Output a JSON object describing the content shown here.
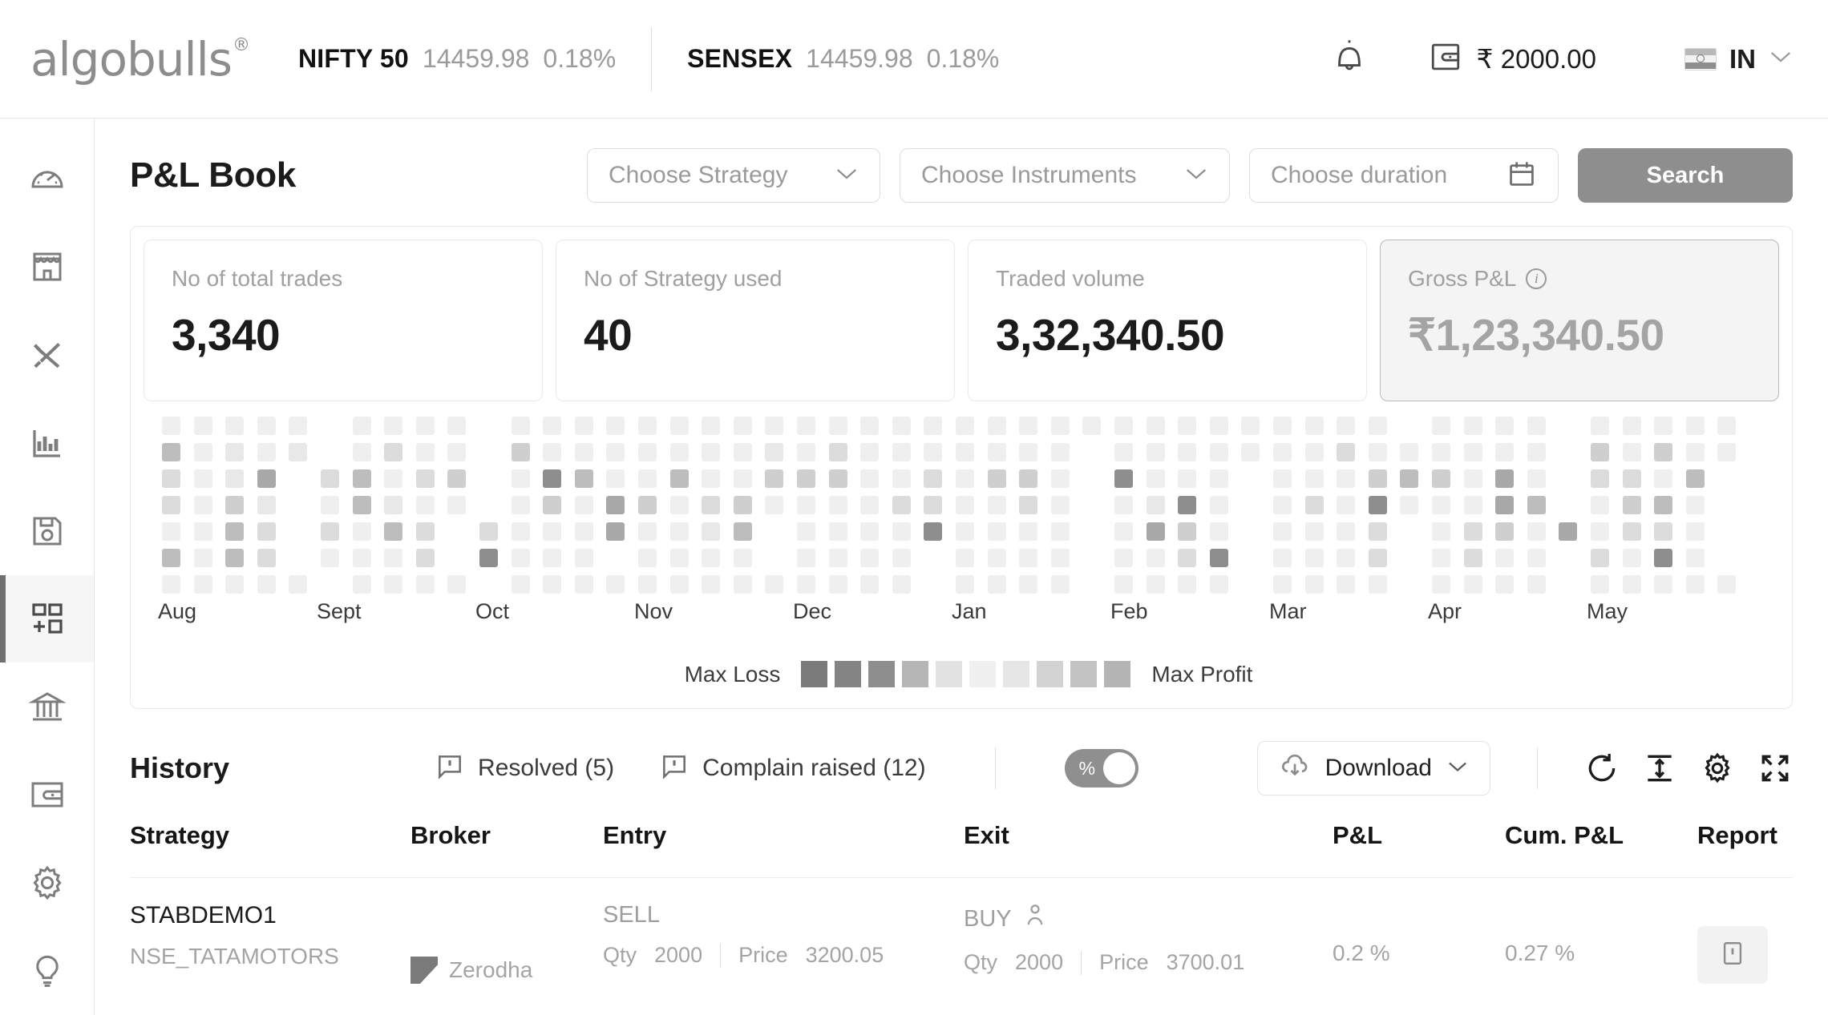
{
  "header": {
    "logo_text": "algobulls",
    "logo_reg": "®",
    "tickers": [
      {
        "name": "NIFTY 50",
        "value": "14459.98",
        "percent": "0.18%"
      },
      {
        "name": "SENSEX",
        "value": "14459.98",
        "percent": "0.18%"
      }
    ],
    "notification_icon": "bell-icon",
    "wallet_icon": "wallet-icon",
    "wallet_amount": "₹ 2000.00",
    "region_code": "IN",
    "region_chevron": "chevron-down-icon"
  },
  "sidebar": {
    "items": [
      {
        "name": "dashboard",
        "icon": "speedometer-icon",
        "active": false
      },
      {
        "name": "marketplace",
        "icon": "store-icon",
        "active": false
      },
      {
        "name": "tools",
        "icon": "tools-icon",
        "active": false
      },
      {
        "name": "analytics",
        "icon": "bar-chart-icon",
        "active": false
      },
      {
        "name": "saved",
        "icon": "floppy-disk-icon",
        "active": false
      },
      {
        "name": "pnl-book",
        "icon": "grid-plus-icon",
        "active": true
      },
      {
        "name": "bank",
        "icon": "bank-icon",
        "active": false
      },
      {
        "name": "wallet",
        "icon": "wallet-icon",
        "active": false
      },
      {
        "name": "settings",
        "icon": "gear-icon",
        "active": false
      },
      {
        "name": "help",
        "icon": "lightbulb-icon",
        "active": false
      }
    ]
  },
  "page": {
    "title": "P&L Book",
    "filters": {
      "strategy_placeholder": "Choose Strategy",
      "instruments_placeholder": "Choose Instruments",
      "duration_placeholder": "Choose duration",
      "calendar_icon": "calendar-icon",
      "chevron_icon": "chevron-down-icon",
      "search_label": "Search"
    }
  },
  "stats": [
    {
      "label": "No of total trades",
      "value": "3,340",
      "info": false,
      "highlight": false
    },
    {
      "label": "No of Strategy used",
      "value": "40",
      "info": false,
      "highlight": false
    },
    {
      "label": "Traded volume",
      "value": "3,32,340.50",
      "info": false,
      "highlight": false
    },
    {
      "label": "Gross P&L",
      "value": "₹1,23,340.50",
      "info": true,
      "highlight": true
    }
  ],
  "chart_data": {
    "type": "heatmap",
    "title": "",
    "xlabel": "",
    "ylabel": "",
    "legend_position": "bottom-center",
    "legend_min_label": "Max Loss",
    "legend_max_label": "Max Profit",
    "legend_swatches": [
      "#7b7b7b",
      "#848484",
      "#8e8e8e",
      "#b6b6b6",
      "#e2e2e2",
      "#f0f0f0",
      "#e6e6e6",
      "#d3d3d3",
      "#c3c3c3",
      "#b4b4b4"
    ],
    "categories": [
      "Aug",
      "Sept",
      "Oct",
      "Nov",
      "Dec",
      "Jan",
      "Feb",
      "Mar",
      "Apr",
      "May"
    ],
    "rows": 7,
    "cols_per_month": 5,
    "scale": [
      "#f7f7f7",
      "#efefef",
      "#e8e8e8",
      "#dcdcdc",
      "#cfcfcf",
      "#bdbdbd",
      "#a8a8a8",
      "#8e8e8e",
      "#7c7c7c"
    ],
    "values": [
      {
        "month": "Aug",
        "grid": [
          [
            1,
            1,
            1,
            1,
            1
          ],
          [
            5,
            1,
            2,
            1,
            2
          ],
          [
            3,
            1,
            2,
            6,
            0
          ],
          [
            3,
            1,
            4,
            2,
            0
          ],
          [
            1,
            1,
            5,
            3,
            0
          ],
          [
            5,
            1,
            5,
            3,
            0
          ],
          [
            1,
            1,
            1,
            1,
            1
          ]
        ]
      },
      {
        "month": "Sept",
        "grid": [
          [
            0,
            1,
            1,
            1,
            1
          ],
          [
            0,
            1,
            3,
            1,
            1
          ],
          [
            3,
            5,
            1,
            3,
            4
          ],
          [
            1,
            5,
            2,
            1,
            1
          ],
          [
            3,
            1,
            5,
            3,
            0
          ],
          [
            1,
            1,
            1,
            3,
            0
          ],
          [
            0,
            1,
            1,
            1,
            1
          ]
        ]
      },
      {
        "month": "Oct",
        "grid": [
          [
            0,
            1,
            1,
            1,
            1
          ],
          [
            0,
            4,
            1,
            1,
            1
          ],
          [
            0,
            1,
            7,
            5,
            1
          ],
          [
            0,
            1,
            4,
            1,
            6
          ],
          [
            3,
            1,
            1,
            1,
            6
          ],
          [
            7,
            1,
            1,
            1,
            0
          ],
          [
            0,
            1,
            1,
            1,
            1
          ]
        ]
      },
      {
        "month": "Nov",
        "grid": [
          [
            1,
            1,
            1,
            1,
            1
          ],
          [
            1,
            1,
            1,
            1,
            2
          ],
          [
            1,
            5,
            1,
            1,
            4
          ],
          [
            4,
            1,
            3,
            4,
            1
          ],
          [
            1,
            1,
            2,
            5,
            0
          ],
          [
            1,
            1,
            1,
            1,
            0
          ],
          [
            1,
            1,
            1,
            1,
            1
          ]
        ]
      },
      {
        "month": "Dec",
        "grid": [
          [
            1,
            1,
            1,
            1,
            1
          ],
          [
            1,
            3,
            1,
            1,
            1
          ],
          [
            4,
            4,
            1,
            1,
            3
          ],
          [
            1,
            1,
            1,
            3,
            3
          ],
          [
            1,
            1,
            1,
            1,
            7
          ],
          [
            1,
            1,
            1,
            1,
            0
          ],
          [
            1,
            1,
            1,
            1,
            0
          ]
        ]
      },
      {
        "month": "Jan",
        "grid": [
          [
            1,
            1,
            1,
            1,
            1
          ],
          [
            1,
            1,
            1,
            1,
            0
          ],
          [
            1,
            4,
            4,
            1,
            0
          ],
          [
            1,
            1,
            3,
            1,
            0
          ],
          [
            1,
            1,
            1,
            1,
            0
          ],
          [
            1,
            1,
            1,
            1,
            0
          ],
          [
            1,
            1,
            1,
            1,
            0
          ]
        ]
      },
      {
        "month": "Feb",
        "grid": [
          [
            1,
            1,
            1,
            1,
            1
          ],
          [
            1,
            1,
            1,
            1,
            1
          ],
          [
            7,
            1,
            1,
            1,
            0
          ],
          [
            1,
            2,
            7,
            1,
            0
          ],
          [
            1,
            6,
            4,
            1,
            0
          ],
          [
            1,
            1,
            3,
            7,
            0
          ],
          [
            1,
            1,
            1,
            1,
            0
          ]
        ]
      },
      {
        "month": "Mar",
        "grid": [
          [
            1,
            1,
            1,
            1,
            0
          ],
          [
            1,
            1,
            3,
            1,
            1
          ],
          [
            1,
            1,
            1,
            4,
            5
          ],
          [
            1,
            3,
            1,
            7,
            1
          ],
          [
            1,
            1,
            1,
            3,
            0
          ],
          [
            1,
            1,
            1,
            3,
            0
          ],
          [
            1,
            1,
            1,
            1,
            0
          ]
        ]
      },
      {
        "month": "Apr",
        "grid": [
          [
            1,
            1,
            1,
            1,
            0
          ],
          [
            1,
            1,
            1,
            1,
            0
          ],
          [
            4,
            1,
            6,
            1,
            0
          ],
          [
            1,
            1,
            6,
            5,
            0
          ],
          [
            1,
            3,
            4,
            1,
            6
          ],
          [
            1,
            3,
            1,
            1,
            0
          ],
          [
            1,
            1,
            1,
            1,
            0
          ]
        ]
      },
      {
        "month": "May",
        "grid": [
          [
            1,
            1,
            1,
            1,
            1
          ],
          [
            4,
            1,
            4,
            1,
            1
          ],
          [
            3,
            3,
            1,
            5,
            0
          ],
          [
            1,
            4,
            5,
            1,
            0
          ],
          [
            1,
            3,
            3,
            1,
            0
          ],
          [
            3,
            1,
            7,
            1,
            0
          ],
          [
            1,
            1,
            1,
            1,
            1
          ]
        ]
      }
    ]
  },
  "history": {
    "title": "History",
    "resolved_label": "Resolved (5)",
    "complain_label": "Complain raised (12)",
    "resolved_icon": "comment-alert-icon",
    "complain_icon": "comment-alert-icon",
    "toggle_label": "%",
    "toggle_on": true,
    "download_label": "Download",
    "download_icon": "cloud-download-icon",
    "download_chevron": "chevron-down-icon",
    "refresh_icon": "refresh-icon",
    "row_height_icon": "row-height-icon",
    "settings_icon": "gear-icon",
    "fullscreen_icon": "fullscreen-icon"
  },
  "table": {
    "columns": [
      "Strategy",
      "Broker",
      "Entry",
      "Exit",
      "P&L",
      "Cum. P&L",
      "Report"
    ],
    "rows": [
      {
        "strategy": "STABDEMO1",
        "instrument": "NSE_TATAMOTORS",
        "broker": "Zerodha",
        "entry_side": "SELL",
        "entry_qty_label": "Qty",
        "entry_qty": "2000",
        "entry_price_label": "Price",
        "entry_price": "3200.05",
        "exit_side": "BUY",
        "exit_icon": "person-icon",
        "exit_qty_label": "Qty",
        "exit_qty": "2000",
        "exit_price_label": "Price",
        "exit_price": "3700.01",
        "pnl": "0.2 %",
        "cum_pnl": "0.27 %",
        "report_icon": "report-icon"
      }
    ]
  }
}
